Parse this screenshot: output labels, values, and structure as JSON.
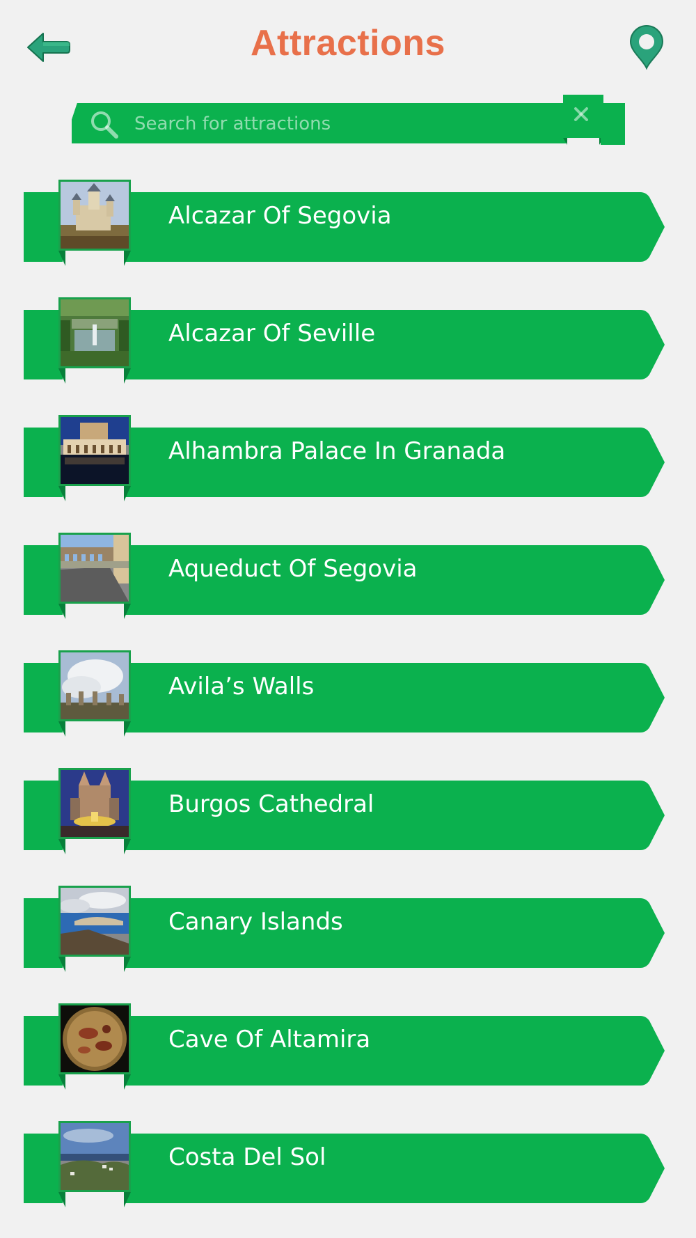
{
  "header": {
    "title": "Attractions",
    "back_icon": "back-arrow-icon",
    "map_icon": "map-pin-icon"
  },
  "search": {
    "placeholder": "Search for attractions",
    "value": "",
    "search_icon": "search-icon",
    "clear_icon": "close-icon"
  },
  "colors": {
    "title": "#e8704a",
    "ribbon": "#0bb14e",
    "ribbon_dark": "#07803a",
    "background": "#f1f1f1"
  },
  "attractions": [
    {
      "label": "Alcazar Of Segovia",
      "thumb": "castle-photo"
    },
    {
      "label": "Alcazar Of Seville",
      "thumb": "garden-fountain-photo"
    },
    {
      "label": "Alhambra Palace In Granada",
      "thumb": "palace-reflection-photo"
    },
    {
      "label": "Aqueduct Of Segovia",
      "thumb": "aqueduct-street-photo"
    },
    {
      "label": "Avila’s Walls",
      "thumb": "walls-clouds-photo"
    },
    {
      "label": "Burgos Cathedral",
      "thumb": "cathedral-night-photo"
    },
    {
      "label": "Canary Islands",
      "thumb": "island-coast-photo"
    },
    {
      "label": "Cave Of Altamira",
      "thumb": "cave-painting-photo"
    },
    {
      "label": "Costa Del Sol",
      "thumb": "coastal-hill-photo"
    }
  ]
}
